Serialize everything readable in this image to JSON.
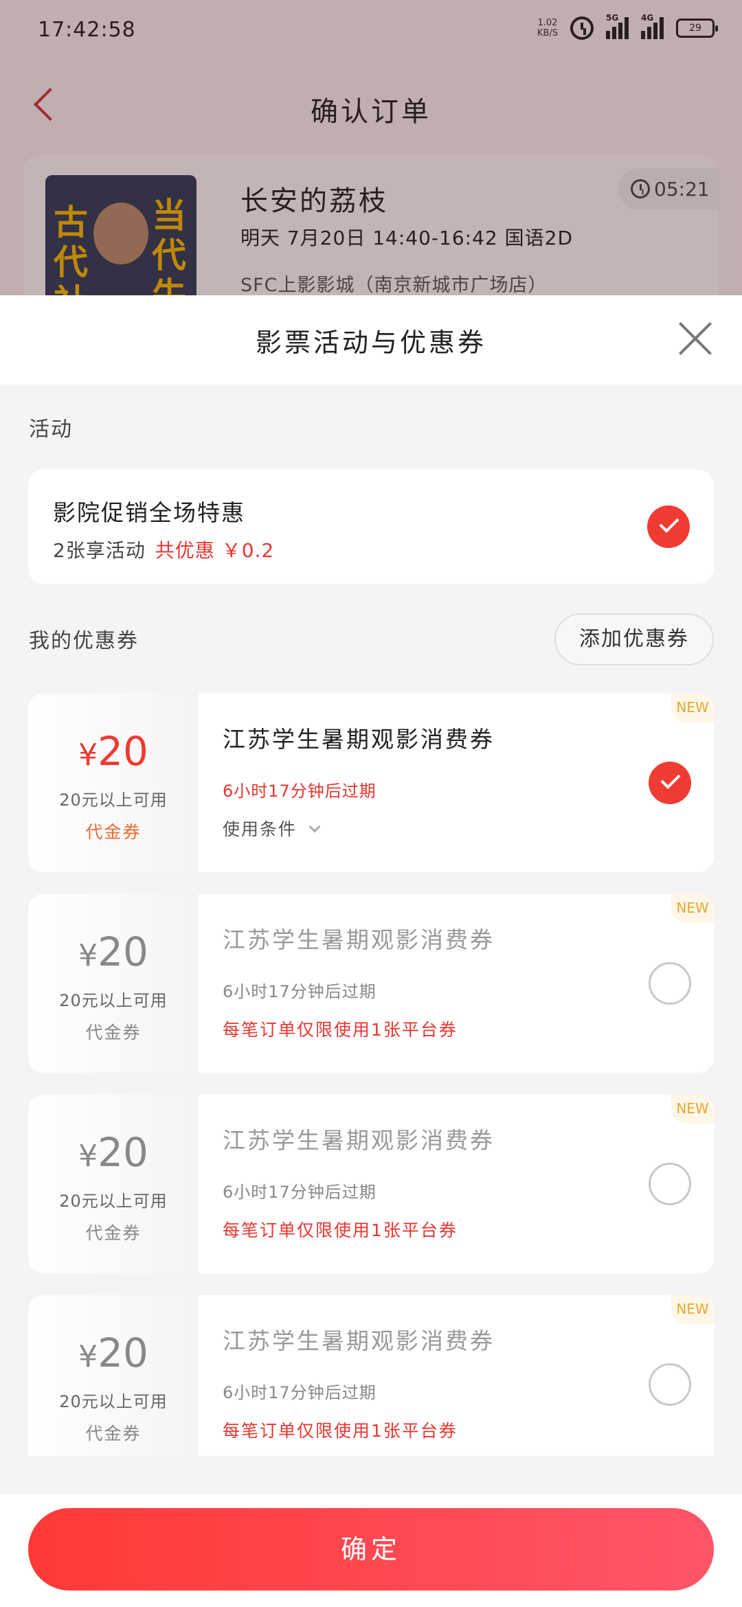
{
  "status_bar": {
    "time": "17:42:58",
    "speed_value": "1.02",
    "speed_unit": "KB/S",
    "net1": "5G",
    "net2": "4G",
    "battery": "29"
  },
  "nav": {
    "title": "确认订单"
  },
  "order": {
    "poster_left": "古代社",
    "poster_right": "当代牛",
    "movie_title": "长安的荔枝",
    "show_time": "明天 7月20日 14:40-16:42 国语2D",
    "cinema": "SFC上影影城（南京新城市广场店）",
    "countdown": "05:21"
  },
  "sheet": {
    "title": "影票活动与优惠券",
    "activity_section_label": "活动",
    "activity": {
      "name": "影院促销全场特惠",
      "sub": "2张享活动",
      "discount": "共优惠 ￥0.2",
      "checked": true
    },
    "coupon_section_label": "我的优惠券",
    "add_coupon_label": "添加优惠券",
    "coupons": [
      {
        "currency": "¥",
        "amount": "20",
        "threshold": "20元以上可用",
        "type": "代金券",
        "name": "江苏学生暑期观影消费券",
        "expire": "6小时17分钟后过期",
        "rule": "使用条件",
        "badge": "NEW",
        "checked": true
      },
      {
        "currency": "¥",
        "amount": "20",
        "threshold": "20元以上可用",
        "type": "代金券",
        "name": "江苏学生暑期观影消费券",
        "expire": "6小时17分钟后过期",
        "rule": "每笔订单仅限使用1张平台券",
        "badge": "NEW",
        "checked": false
      },
      {
        "currency": "¥",
        "amount": "20",
        "threshold": "20元以上可用",
        "type": "代金券",
        "name": "江苏学生暑期观影消费券",
        "expire": "6小时17分钟后过期",
        "rule": "每笔订单仅限使用1张平台券",
        "badge": "NEW",
        "checked": false
      },
      {
        "currency": "¥",
        "amount": "20",
        "threshold": "20元以上可用",
        "type": "代金券",
        "name": "江苏学生暑期观影消费券",
        "expire": "6小时17分钟后过期",
        "rule": "每笔订单仅限使用1张平台券",
        "badge": "NEW",
        "checked": false
      }
    ],
    "confirm_label": "确定"
  },
  "colors": {
    "accent": "#f03b32",
    "button_start": "#ff3a36",
    "button_end": "#ff5569",
    "badge_text": "#e7a832"
  }
}
